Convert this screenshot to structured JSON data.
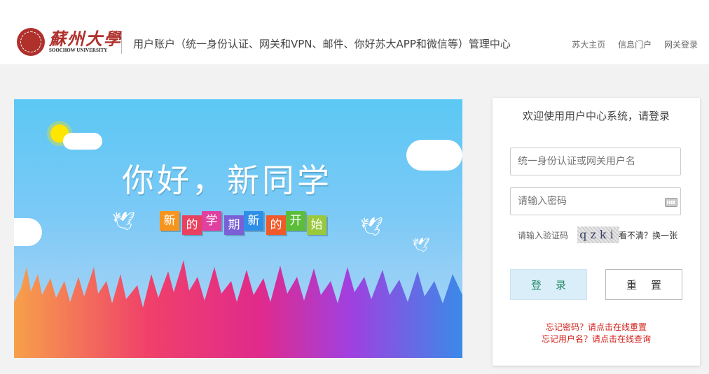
{
  "header": {
    "logo_cn": "蘇州大學",
    "logo_en": "SOOCHOW UNIVERSITY",
    "system_title": "用户账户（统一身份认证、网关和VPN、邮件、你好苏大APP和微信等）管理中心",
    "nav": [
      "苏大主页",
      "信息门户",
      "网关登录"
    ]
  },
  "banner": {
    "title": "你好，新同学",
    "chips": [
      "新",
      "的",
      "学",
      "期",
      "新",
      "的",
      "开",
      "始"
    ],
    "chip_colors": [
      "#f7941d",
      "#e8405e",
      "#e040a0",
      "#7a5fd6",
      "#2f8fe8",
      "#f05a2a",
      "#5bbd3a",
      "#98c93c"
    ]
  },
  "login": {
    "welcome": "欢迎使用用户中心系统，请登录",
    "username_placeholder": "统一身份认证或网关用户名",
    "password_placeholder": "请输入密码",
    "captcha_label": "请输入验证码",
    "captcha_text": "qzki",
    "captcha_refresh": "看不清？换一张",
    "login_button": "登录",
    "reset_button": "重置",
    "forgot_password": "忘记密码？请点击在线重置",
    "forgot_username": "忘记用户名？请点击在线查询"
  }
}
